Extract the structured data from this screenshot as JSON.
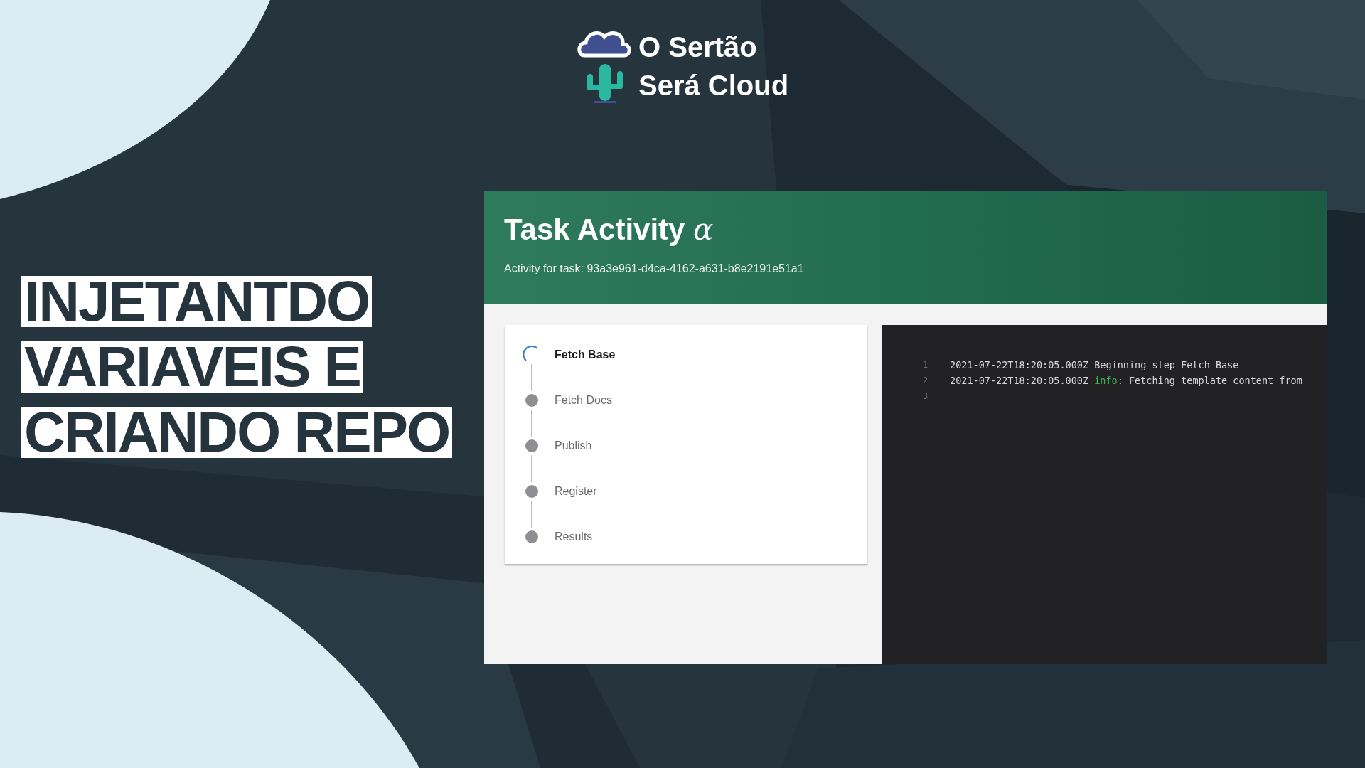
{
  "brand": {
    "lines": [
      "O Sertão",
      "Será Cloud"
    ]
  },
  "headline": [
    "INJETANTDO",
    "VARIAVEIS E",
    "CRIANDO REPO"
  ],
  "app": {
    "title": "Task Activity",
    "title_symbol": "α",
    "subtitle": "Activity for task: 93a3e961-d4ca-4162-a631-b8e2191e51a1",
    "steps": [
      {
        "label": "Fetch Base",
        "active": true
      },
      {
        "label": "Fetch Docs",
        "active": false
      },
      {
        "label": "Publish",
        "active": false
      },
      {
        "label": "Register",
        "active": false
      },
      {
        "label": "Results",
        "active": false
      }
    ],
    "log": [
      {
        "number": "1",
        "timestamp": "2021-07-22T18:20:05.000Z",
        "message": "Beginning step Fetch Base"
      },
      {
        "number": "2",
        "timestamp": "2021-07-22T18:20:05.000Z",
        "level": "info",
        "message": ": Fetching template content from"
      },
      {
        "number": "3"
      }
    ]
  }
}
